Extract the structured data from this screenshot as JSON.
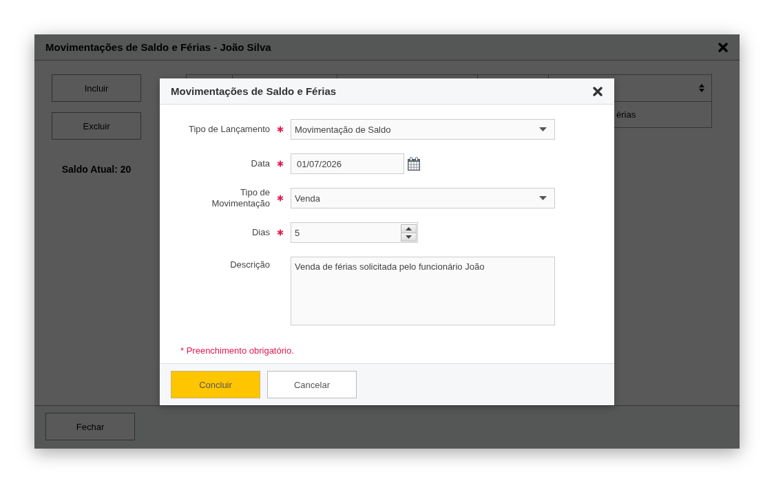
{
  "window": {
    "title": "Movimentações de Saldo e Férias - João Silva"
  },
  "actions": [
    "Incluir",
    "Excluir"
  ],
  "balance": "Saldo Atual: 20",
  "table": {
    "rows": [
      {
        "column_5": "érias"
      }
    ]
  },
  "footer": {
    "buttons": [
      "Fechar"
    ]
  },
  "dialog": {
    "title": "Movimentações de Saldo e Férias",
    "fields": [
      {
        "kind": "select",
        "label": "Tipo de Lançamento",
        "required": true,
        "value": "Movimentação de Saldo"
      },
      {
        "kind": "date",
        "label": "Data",
        "required": true,
        "value": "01/07/2026"
      },
      {
        "kind": "select",
        "label": "Tipo de Movimentação",
        "required": true,
        "value": "Venda"
      },
      {
        "kind": "number",
        "label": "Dias",
        "required": true,
        "value": "5"
      },
      {
        "kind": "textarea",
        "label": "Descrição",
        "required": false,
        "value": "Venda de férias solicitada pelo funcionário João"
      }
    ],
    "required_note": "* Preenchimento obrigatório.",
    "buttons": [
      {
        "label": "Concluir",
        "kind": "primary"
      },
      {
        "label": "Cancelar",
        "kind": "secondary"
      }
    ]
  }
}
